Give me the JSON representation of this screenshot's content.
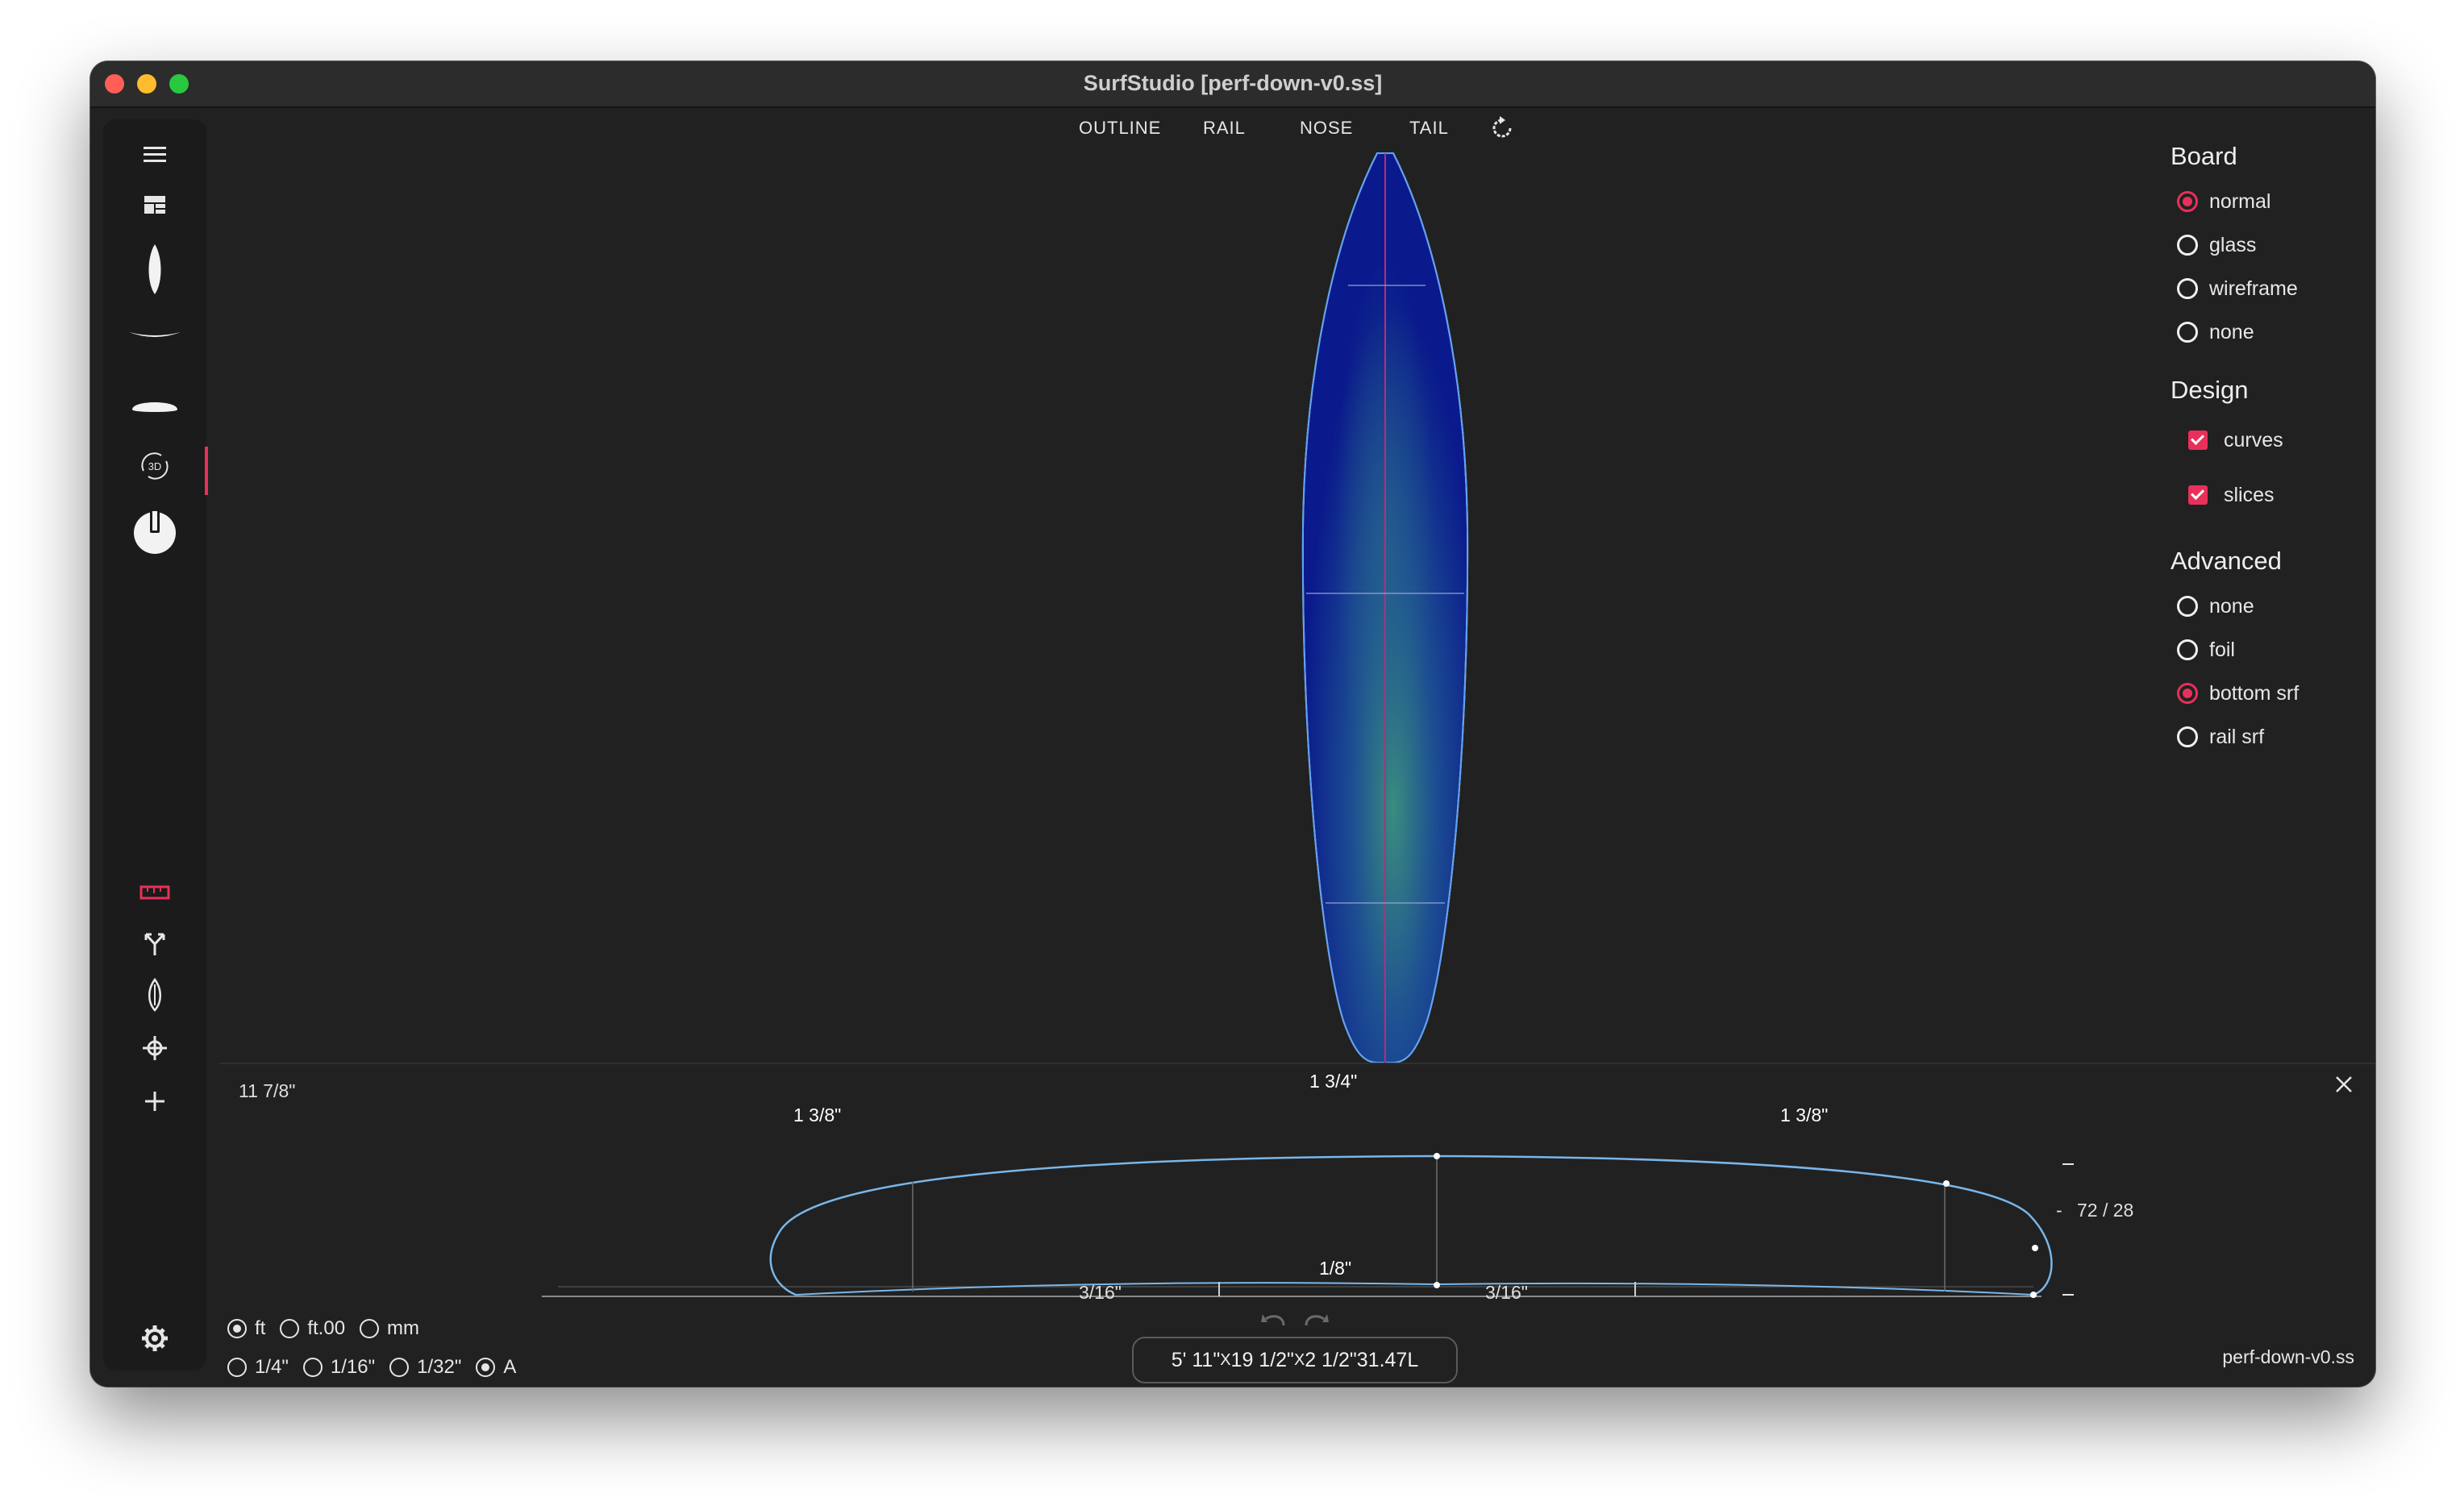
{
  "window": {
    "title": "SurfStudio [perf-down-v0.ss]"
  },
  "toolbar": {
    "tools": [
      "menu-icon",
      "dashboard-icon",
      "board-outline-icon",
      "rocker-icon",
      "rail-icon",
      "rotate-3d-icon",
      "fin-knob-icon",
      "ruler-icon",
      "split-arrows-icon",
      "board-small-icon",
      "crosshair-icon",
      "add-icon",
      "settings-icon"
    ],
    "rotate_3d_label": "3D",
    "accent": "#e8305a"
  },
  "view_tabs": [
    "OUTLINE",
    "RAIL",
    "NOSE",
    "TAIL"
  ],
  "right_panel": {
    "board": {
      "title": "Board",
      "options": [
        "normal",
        "glass",
        "wireframe",
        "none"
      ],
      "selected": "normal"
    },
    "design": {
      "title": "Design",
      "checks": [
        {
          "label": "curves",
          "checked": true
        },
        {
          "label": "slices",
          "checked": true
        }
      ]
    },
    "advanced": {
      "title": "Advanced",
      "options": [
        "none",
        "foil",
        "bottom srf",
        "rail srf"
      ],
      "selected": "bottom srf"
    }
  },
  "profile": {
    "width_label": "11 7/8\"",
    "thickness_center": "1 3/4\"",
    "thickness_left": "1 3/8\"",
    "thickness_right": "1 3/8\"",
    "bottom_center": "1/8\"",
    "bottom_left": "3/16\"",
    "bottom_right": "3/16\"",
    "ratio": "72 / 28"
  },
  "units": {
    "row1": [
      {
        "label": "ft",
        "selected": true
      },
      {
        "label": "ft.00",
        "selected": false
      },
      {
        "label": "mm",
        "selected": false
      }
    ],
    "row2": [
      {
        "label": "1/4\"",
        "selected": false
      },
      {
        "label": "1/16\"",
        "selected": false
      },
      {
        "label": "1/32\"",
        "selected": false
      },
      {
        "label": "A",
        "selected": true
      }
    ]
  },
  "dimensions": {
    "length": "5' 11\"",
    "x1": "X",
    "width": "19 1/2\"",
    "x2": "X",
    "thickness": "2 1/2\"",
    "volume": "31.47L"
  },
  "status": {
    "filename": "perf-down-v0.ss"
  }
}
